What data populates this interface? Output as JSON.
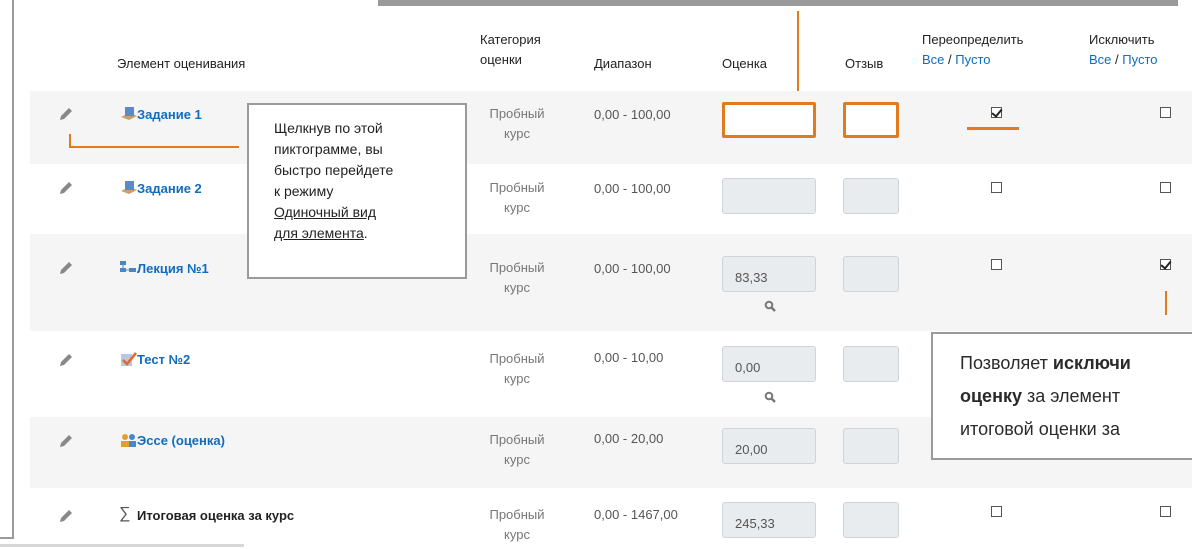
{
  "headers": {
    "item": "Элемент оценивания",
    "category_line1": "Категория",
    "category_line2": "оценки",
    "range": "Диапазон",
    "grade": "Оценка",
    "feedback": "Отзыв",
    "override": "Переопределить",
    "exclude": "Исключить",
    "all": "Все",
    "sep": " / ",
    "none": "Пусто"
  },
  "rows": [
    {
      "name": "Задание 1",
      "icon": "assignment-icon",
      "cat1": "Пробный",
      "cat2": "курс",
      "range": "0,00 - 100,00",
      "grade": "",
      "override": true,
      "exclude": false
    },
    {
      "name": "Задание 2",
      "icon": "assignment-icon",
      "cat1": "Пробный",
      "cat2": "курс",
      "range": "0,00 - 100,00",
      "grade": "",
      "override": false,
      "exclude": false
    },
    {
      "name": "Лекция №1",
      "icon": "lesson-icon",
      "cat1": "Пробный",
      "cat2": "курс",
      "range": "0,00 - 100,00",
      "grade": "83,33",
      "override": false,
      "exclude": true
    },
    {
      "name": "Тест №2",
      "icon": "quiz-icon",
      "cat1": "Пробный",
      "cat2": "курс",
      "range": "0,00 - 10,00",
      "grade": "0,00",
      "override": false,
      "exclude": false
    },
    {
      "name": "Эссе (оценка)",
      "icon": "workshop-icon",
      "cat1": "Пробный",
      "cat2": "курс",
      "range": "0,00 - 20,00",
      "grade": "20,00",
      "override": false,
      "exclude": false
    },
    {
      "name": "Итоговая оценка за курс",
      "icon": "sigma-icon",
      "cat1": "Пробный",
      "cat2": "курс",
      "range": "0,00 - 1467,00",
      "grade": "245,33",
      "override": false,
      "exclude": false
    }
  ],
  "tooltip1": {
    "line1": "Щелкнув по этой",
    "line2": "пиктограмме, вы",
    "line3": "быстро перейдете",
    "line4": "к режиму",
    "link1": "Одиночный вид",
    "link2": "для элемента",
    "tail": "."
  },
  "tooltip2": {
    "p1": "Позволяет ",
    "b1": "исключи",
    "b2": "оценку",
    "p2": " за элемент",
    "p3": "итоговой оценки за"
  },
  "colors": {
    "accent": "#e07b1f",
    "link": "#0f6cbf"
  }
}
